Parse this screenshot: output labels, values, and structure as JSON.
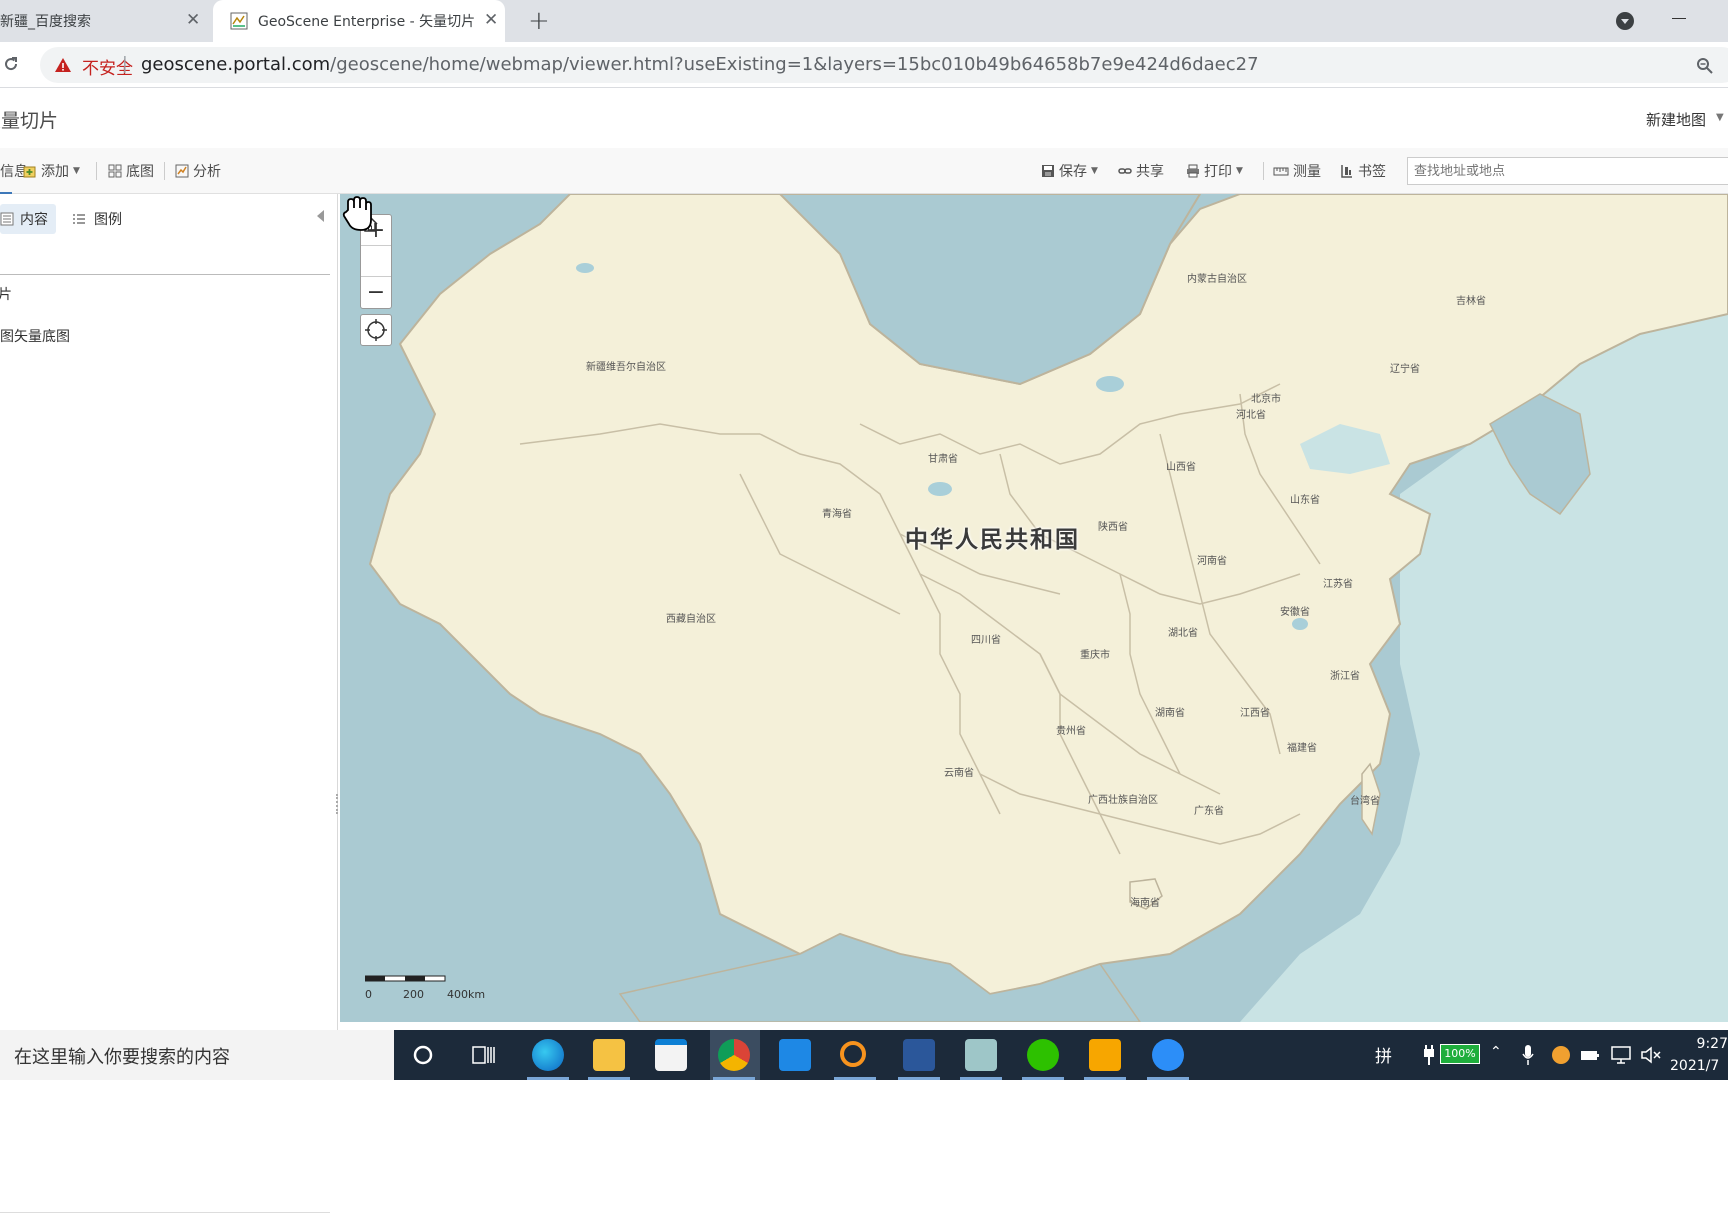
{
  "browser": {
    "tabs": [
      {
        "title": "新疆_百度搜索",
        "close": "✕"
      },
      {
        "title": "GeoScene Enterprise - 矢量切片",
        "close": "✕"
      }
    ],
    "new_tab": "+",
    "address": {
      "security_label": "不安全",
      "separator": "|",
      "host": "geoscene.portal.com",
      "path": "/geoscene/home/webmap/viewer.html?useExisting=1&layers=15bc010b49b64658b7e9e424d6daec27"
    },
    "bookmark_icon": "star-icon"
  },
  "app": {
    "title": "矢量切片",
    "new_map": "新建地图",
    "toolbar": {
      "details": "详细信息",
      "add": "添加",
      "basemap": "底图",
      "analysis": "分析",
      "save": "保存",
      "share": "共享",
      "print": "打印",
      "measure": "测量",
      "bookmarks": "书签",
      "search_placeholder": "查找地址或地点"
    }
  },
  "panel": {
    "tab_content": "内容",
    "tab_legend": "图例",
    "layers": [
      {
        "label": "矢量切片"
      },
      {
        "label": "地图矢量底图"
      }
    ]
  },
  "map": {
    "colors": {
      "water": "#aacad2",
      "land": "#f4f0d9",
      "border": "#bdb49c"
    },
    "country": "中华人民共和国",
    "regions": [
      {
        "name": "内蒙古自治区"
      },
      {
        "name": "吉林省"
      },
      {
        "name": "新疆维吾尔自治区"
      },
      {
        "name": "辽宁省"
      },
      {
        "name": "北京市"
      },
      {
        "name": "河北省"
      },
      {
        "name": "甘肃省"
      },
      {
        "name": "山西省"
      },
      {
        "name": "山东省"
      },
      {
        "name": "青海省"
      },
      {
        "name": "陕西省"
      },
      {
        "name": "河南省"
      },
      {
        "name": "江苏省"
      },
      {
        "name": "安徽省"
      },
      {
        "name": "西藏自治区"
      },
      {
        "name": "四川省"
      },
      {
        "name": "湖北省"
      },
      {
        "name": "重庆市"
      },
      {
        "name": "浙江省"
      },
      {
        "name": "湖南省"
      },
      {
        "name": "江西省"
      },
      {
        "name": "贵州省"
      },
      {
        "name": "福建省"
      },
      {
        "name": "云南省"
      },
      {
        "name": "台湾省"
      },
      {
        "name": "广西壮族自治区"
      },
      {
        "name": "广东省"
      },
      {
        "name": "海南省"
      }
    ],
    "zoom_in": "+",
    "zoom_out": "−",
    "scale": {
      "ticks": [
        "0",
        "200",
        "400km"
      ]
    }
  },
  "taskbar": {
    "search_placeholder": "在这里输入你要搜索的内容",
    "ime": "拼",
    "battery": "100%",
    "time": "9:27",
    "date": "2021/7"
  }
}
